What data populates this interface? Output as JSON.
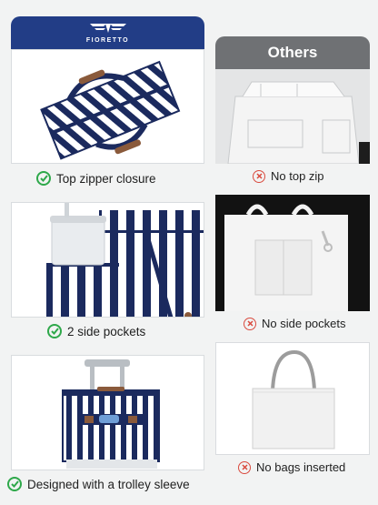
{
  "brand": {
    "name": "FIORETTO",
    "logo": "fioretto-wing-logo",
    "color": "#223d86"
  },
  "comparison": {
    "header": "Others",
    "color": "#6f7174"
  },
  "features": [
    {
      "label": "Top zipper closure",
      "icon": "check-icon"
    },
    {
      "label": "2 side pockets",
      "icon": "check-icon"
    },
    {
      "label": "Designed with a trolley sleeve",
      "icon": "check-icon"
    }
  ],
  "others_features": [
    {
      "label": "No top zip",
      "icon": "cross-icon"
    },
    {
      "label": "No side pockets",
      "icon": "cross-icon"
    },
    {
      "label": "No bags inserted",
      "icon": "cross-icon"
    }
  ],
  "colors": {
    "check": "#2ea84a",
    "cross": "#d94a3e",
    "stripe_navy": "#1b2a5e",
    "handle": "#8a5a3b"
  }
}
